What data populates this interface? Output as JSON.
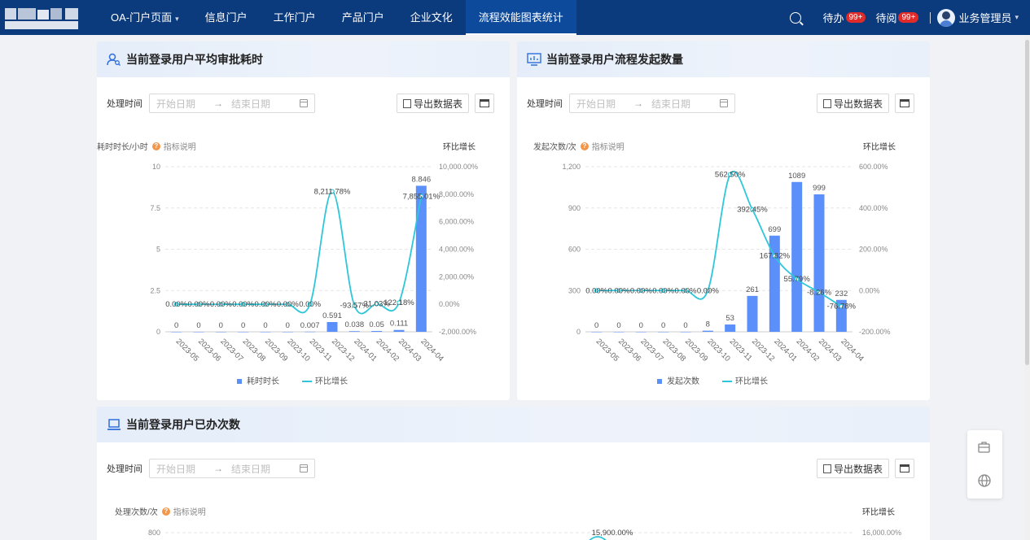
{
  "nav": [
    {
      "label": "OA-门户页面",
      "caret": true,
      "active": false
    },
    {
      "label": "信息门户",
      "caret": false,
      "active": false
    },
    {
      "label": "工作门户",
      "caret": false,
      "active": false
    },
    {
      "label": "产品门户",
      "caret": false,
      "active": false
    },
    {
      "label": "企业文化",
      "caret": false,
      "active": false
    },
    {
      "label": "流程效能图表统计",
      "caret": false,
      "active": true
    }
  ],
  "topbar": {
    "todo_label": "待办",
    "todo_badge": "99+",
    "toread_label": "待阅",
    "toread_badge": "99+",
    "user_name": "业务管理员"
  },
  "colors": {
    "bar": "#5b8ff9",
    "line": "#2ec7d9",
    "topbar": "#0b3a7d"
  },
  "panels": [
    {
      "title": "当前登录用户平均审批耗时",
      "filter_label": "处理时间",
      "start_placeholder": "开始日期",
      "end_placeholder": "结束日期",
      "export_label": "导出数据表",
      "y_label": "耗时时长/小时",
      "hint_label": "指标说明",
      "y2_label": "环比增长"
    },
    {
      "title": "当前登录用户流程发起数量",
      "filter_label": "处理时间",
      "start_placeholder": "开始日期",
      "end_placeholder": "结束日期",
      "export_label": "导出数据表",
      "y_label": "发起次数/次",
      "hint_label": "指标说明",
      "y2_label": "环比增长"
    },
    {
      "title": "当前登录用户已办次数",
      "filter_label": "处理时间",
      "start_placeholder": "开始日期",
      "end_placeholder": "结束日期",
      "export_label": "导出数据表",
      "y_label": "处理次数/次",
      "hint_label": "指标说明",
      "y2_label": "环比增长"
    }
  ],
  "chart_data": [
    {
      "type": "bar",
      "categories": [
        "2023-05",
        "2023-06",
        "2023-07",
        "2023-08",
        "2023-09",
        "2023-10",
        "2023-11",
        "2023-12",
        "2024-01",
        "2024-02",
        "2024-03",
        "2024-04"
      ],
      "series": [
        {
          "name": "耗时时长",
          "type": "bar",
          "values": [
            0,
            0,
            0,
            0,
            0,
            0,
            0.007,
            0.591,
            0.038,
            0.05,
            0.111,
            8.846
          ],
          "labels": [
            "0",
            "0",
            "0",
            "0",
            "0",
            "0",
            "0.007",
            "0.591",
            "0.038",
            "0.05",
            "0.111",
            "8.846"
          ]
        },
        {
          "name": "环比增长",
          "type": "line",
          "axis": "right",
          "values": [
            0,
            0,
            0,
            0,
            0,
            0,
            0,
            8211.78,
            -93.57,
            31.03,
            122.18,
            7855.01
          ],
          "labels": [
            "0.00%",
            "0.00%",
            "0.00%",
            "0.00%",
            "0.00%",
            "0.00%",
            "0.00%",
            "8,211.78%",
            "-93.57%",
            "31.03%",
            "122.18%",
            "7,855.01%"
          ]
        }
      ],
      "y_ticks": [
        "0",
        "2.5",
        "5",
        "7.5",
        "10"
      ],
      "y_ticks_right": [
        "-2,000.00%",
        "0.00%",
        "2,000.00%",
        "4,000.00%",
        "6,000.00%",
        "8,000.00%",
        "10,000.00%"
      ],
      "ylim": [
        0,
        10
      ],
      "y2lim": [
        -2000,
        10000
      ],
      "legend": "bottom"
    },
    {
      "type": "bar",
      "categories": [
        "2023-05",
        "2023-06",
        "2023-07",
        "2023-08",
        "2023-09",
        "2023-10",
        "2023-11",
        "2023-12",
        "2024-01",
        "2024-02",
        "2024-03",
        "2024-04"
      ],
      "series": [
        {
          "name": "发起次数",
          "type": "bar",
          "values": [
            0,
            0,
            0,
            0,
            0,
            8,
            53,
            261,
            699,
            1089,
            999,
            232
          ],
          "labels": [
            "0",
            "0",
            "0",
            "0",
            "0",
            "8",
            "53",
            "261",
            "699",
            "1089",
            "999",
            "232"
          ]
        },
        {
          "name": "环比增长",
          "type": "line",
          "axis": "right",
          "values": [
            0,
            0,
            0,
            0,
            0,
            0,
            562.5,
            392.45,
            167.82,
            55.79,
            -8.26,
            -76.78
          ],
          "labels": [
            "0.00%",
            "0.00%",
            "0.00%",
            "0.00%",
            "0.00%",
            "0.00%",
            "562.50%",
            "392.45%",
            "167.82%",
            "55.79%",
            "-8.26%",
            "-76.78%"
          ]
        }
      ],
      "y_ticks": [
        "0",
        "300",
        "600",
        "900",
        "1,200"
      ],
      "y_ticks_right": [
        "-200.00%",
        "0.00%",
        "200.00%",
        "400.00%",
        "600.00%"
      ],
      "ylim": [
        0,
        1200
      ],
      "y2lim": [
        -200,
        600
      ],
      "legend": "bottom"
    },
    {
      "type": "bar",
      "partial": true,
      "visible_y_tick": "800",
      "visible_y_tick_right": "16,000.00%",
      "visible_line_label": "15,900.00%"
    }
  ]
}
